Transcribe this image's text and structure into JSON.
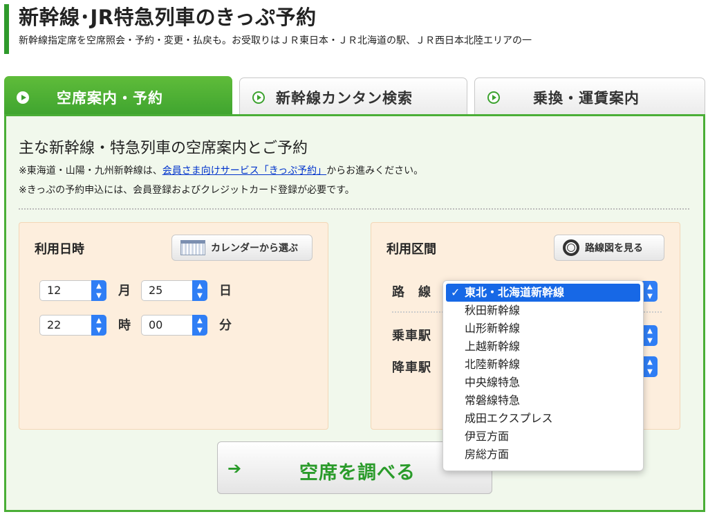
{
  "header": {
    "title": "新幹線･JR特急列車のきっぷ予約",
    "subtitle": "新幹線指定席を空席照会・予約・変更・払戻も。お受取りはＪＲ東日本・ＪＲ北海道の駅、ＪＲ西日本北陸エリアの一"
  },
  "tabs": [
    {
      "label": "空席案内・予約",
      "active": true
    },
    {
      "label": "新幹線カンタン検索",
      "active": false
    },
    {
      "label": "乗換・運賃案内",
      "active": false
    }
  ],
  "panel": {
    "heading": "主な新幹線・特急列車の空席案内とご予約",
    "note1_prefix": "※東海道・山陽・九州新幹線は、",
    "note1_link": "会員さま向けサービス「きっぷ予約」",
    "note1_suffix": "からお進みください。",
    "note2": "※きっぷの予約申込には、会員登録およびクレジットカード登録が必要です。"
  },
  "date_box": {
    "heading": "利用日時",
    "calendar_button": "カレンダーから選ぶ",
    "month": "12",
    "month_unit": "月",
    "day": "25",
    "day_unit": "日",
    "hour": "22",
    "hour_unit": "時",
    "minute": "00",
    "minute_unit": "分"
  },
  "route_box": {
    "heading": "利用区間",
    "map_button": "路線図を見る",
    "line_label": "路　線",
    "board_label": "乗車駅",
    "alight_label": "降車駅"
  },
  "search_button": "空席を調べる",
  "line_dropdown": {
    "selected": "東北・北海道新幹線",
    "options": [
      "東北・北海道新幹線",
      "秋田新幹線",
      "山形新幹線",
      "上越新幹線",
      "北陸新幹線",
      "中央線特急",
      "常磐線特急",
      "成田エクスプレス",
      "伊豆方面",
      "房総方面"
    ]
  },
  "colors": {
    "accent_green": "#3ca22e",
    "select_blue": "#2f7ef5",
    "link_blue": "#0033cc",
    "box_peach": "#fdeedd"
  }
}
